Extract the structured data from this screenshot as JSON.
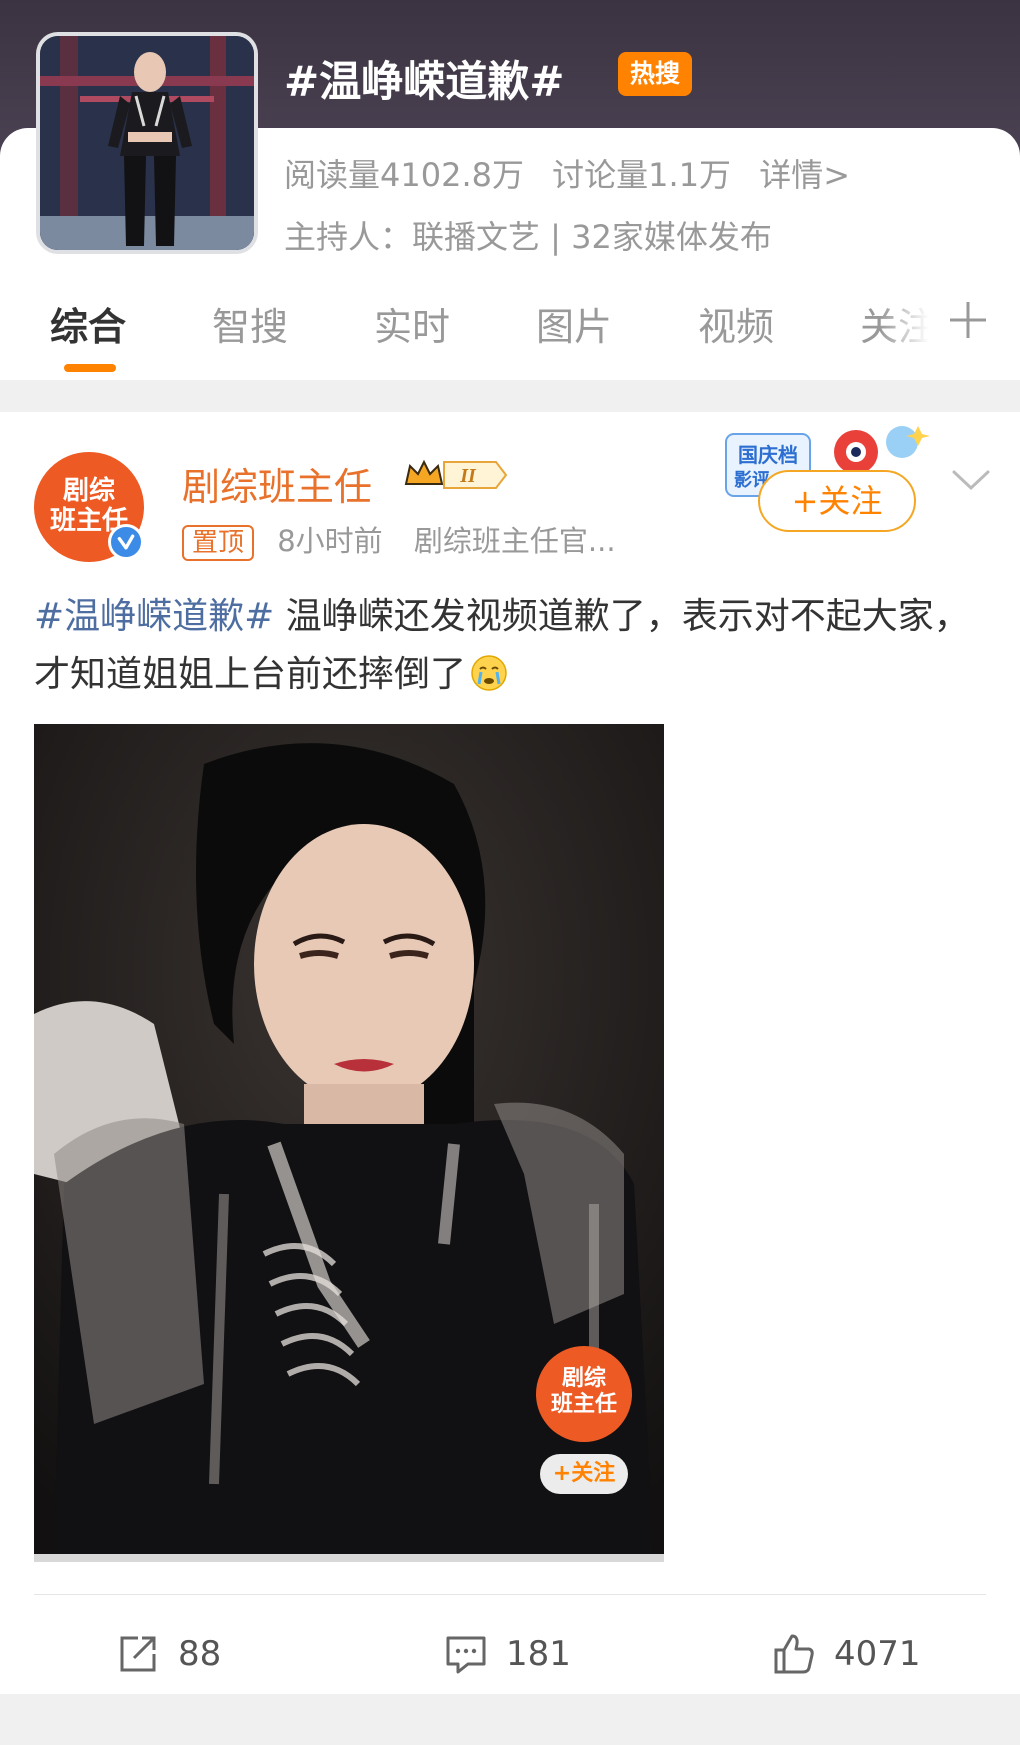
{
  "topic": {
    "title": "#温峥嵘道歉#",
    "badge": "热搜",
    "reads": "阅读量4102.8万",
    "discussions": "讨论量1.1万",
    "details_link": "详情>",
    "host_line": "主持人：联播文艺 | 32家媒体发布"
  },
  "tabs": [
    {
      "label": "综合",
      "active": true
    },
    {
      "label": "智搜",
      "active": false
    },
    {
      "label": "实时",
      "active": false
    },
    {
      "label": "图片",
      "active": false
    },
    {
      "label": "视频",
      "active": false
    },
    {
      "label": "关注",
      "active": false
    }
  ],
  "tab_add_icon": "plus-icon",
  "post": {
    "author": "剧综班主任",
    "avatar_text": "剧综\n班主任",
    "member_badge": "II",
    "pinned_label": "置顶",
    "time": "8小时前",
    "source": "剧综班主任官...",
    "promo_text": "国庆档 影评",
    "follow_label": "+关注",
    "hashtag": "#温峥嵘道歉#",
    "body": " 温峥嵘还发视频道歉了，表示对不起大家，才知道姐姐上台前还摔倒了",
    "emoji": "crying-face-icon",
    "watermark_logo_text": "剧综\n班主任",
    "watermark_follow": "+关注",
    "actions": {
      "reposts": "88",
      "comments": "181",
      "likes": "4071"
    }
  },
  "colors": {
    "accent": "#ff8200",
    "author_name": "#e8722c",
    "hashtag": "#4e6ea1",
    "header_bg": "#3b3341"
  }
}
